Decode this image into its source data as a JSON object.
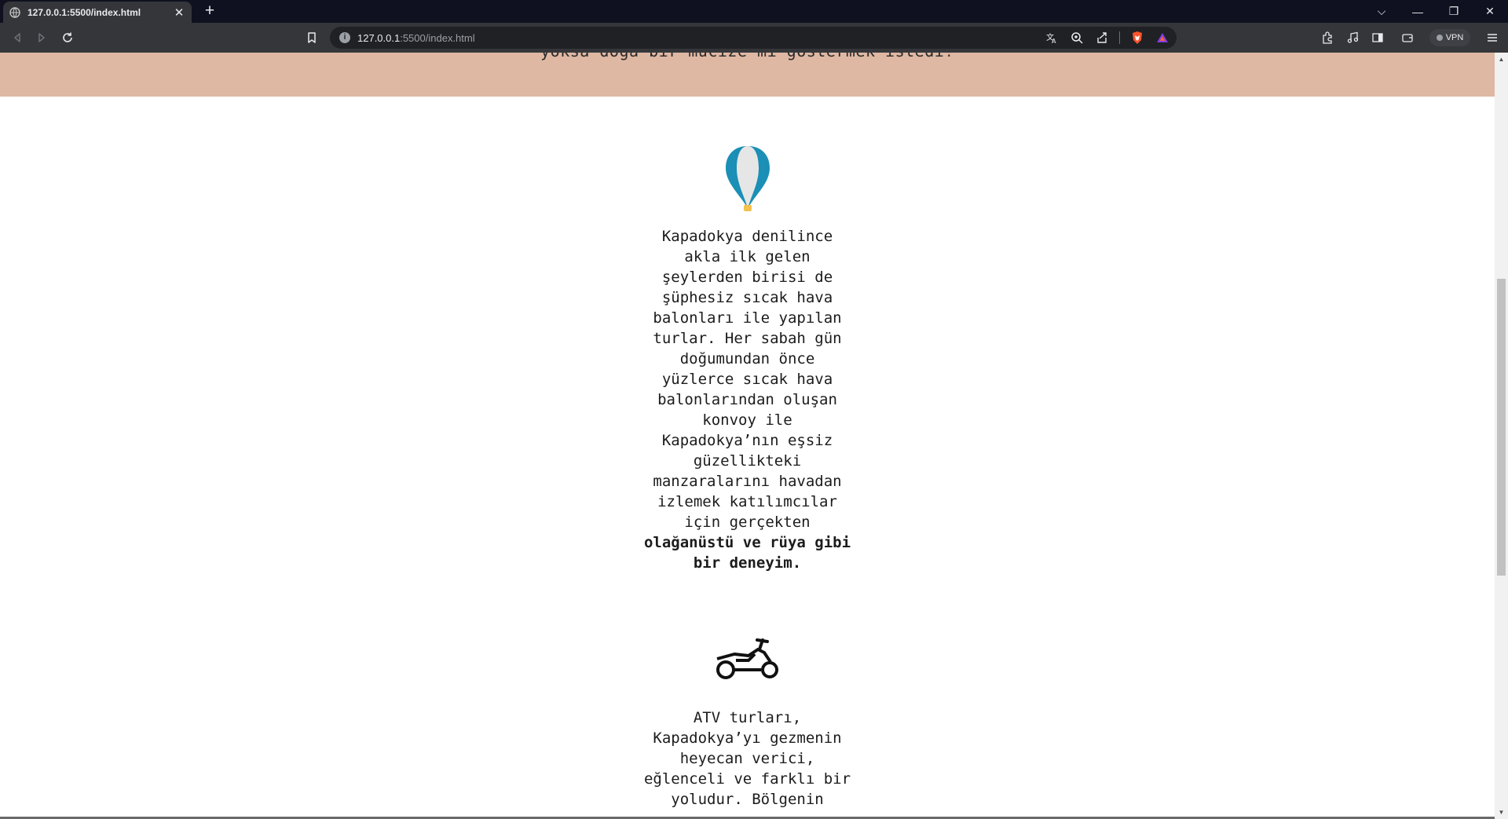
{
  "browser": {
    "tab_title": "127.0.0.1:5500/index.html",
    "tab_close": "✕",
    "new_tab": "+",
    "url_host": "127.0.0.1",
    "url_rest": ":5500/index.html",
    "vpn_label": "VPN",
    "window_controls": {
      "dropdown": "⌵",
      "minimize": "—",
      "restore": "❐",
      "close": "✕"
    }
  },
  "page": {
    "hero_cut_text": "yoksa doğa bir mucize mi göstermek istedi!",
    "balloon_section": {
      "text": "Kapadokya denilince akla ilk gelen şeylerden birisi de şüphesiz sıcak hava balonları ile yapılan turlar. Her sabah gün doğumundan önce yüzlerce sıcak hava balonlarından oluşan konvoy ile Kapadokya’nın eşsiz güzellikteki manzaralarını havadan izlemek katılımcılar için gerçekten",
      "bold": "olağanüstü ve rüya gibi bir deneyim."
    },
    "atv_section": {
      "text": "ATV turları, Kapadokya’yı gezmenin heyecan verici, eğlenceli ve farklı bir yoludur. Bölgenin"
    }
  },
  "colors": {
    "hero_bg": "#dfb8a3",
    "balloon_blue": "#1b8fb5",
    "balloon_light": "#e6e6e6",
    "basket": "#f2c14e",
    "chrome_dark": "#0f1120",
    "chrome_toolbar": "#35363a"
  }
}
